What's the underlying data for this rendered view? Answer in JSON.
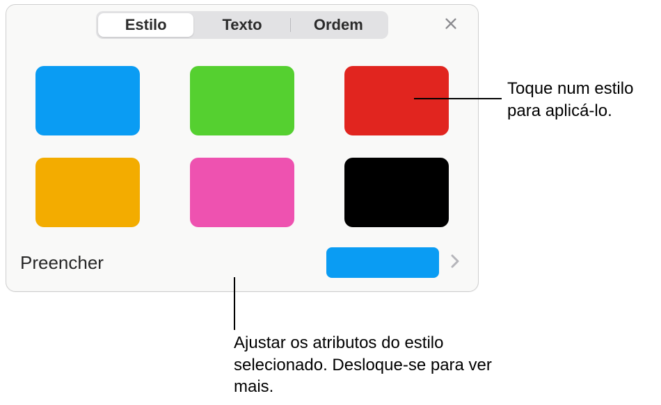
{
  "tabs": {
    "style": {
      "label": "Estilo",
      "active": true
    },
    "text": {
      "label": "Texto",
      "active": false
    },
    "order": {
      "label": "Ordem",
      "active": false
    }
  },
  "swatches": [
    {
      "name": "blue",
      "color": "#0a9cf3"
    },
    {
      "name": "green",
      "color": "#55d030"
    },
    {
      "name": "red",
      "color": "#e1251f"
    },
    {
      "name": "yellow",
      "color": "#f3ac00"
    },
    {
      "name": "pink",
      "color": "#ee52b0"
    },
    {
      "name": "black",
      "color": "#000000"
    }
  ],
  "fill": {
    "label": "Preencher",
    "current_color": "#0a9cf3"
  },
  "callouts": {
    "apply": "Toque num estilo para aplicá-lo.",
    "adjust": "Ajustar os atributos do estilo selecionado. Desloque-se para ver mais."
  }
}
